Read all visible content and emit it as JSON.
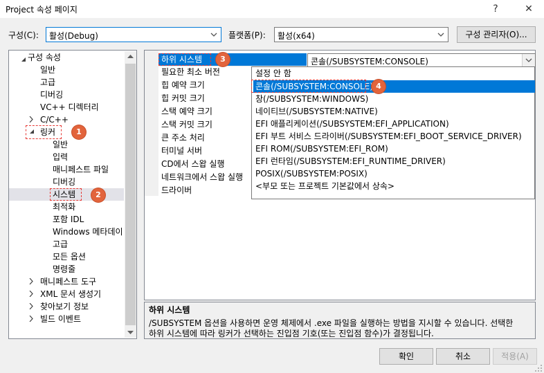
{
  "window": {
    "title": "Project 속성 페이지",
    "help_glyph": "?",
    "close_glyph": "✕"
  },
  "toolbar": {
    "config_label": "구성(C):",
    "config_value": "활성(Debug)",
    "platform_label": "플랫폼(P):",
    "platform_value": "활성(x64)",
    "config_manager_label": "구성 관리자(O)..."
  },
  "tree": {
    "items": [
      {
        "label": "구성 속성",
        "expanded": true
      },
      {
        "label": "일반"
      },
      {
        "label": "고급"
      },
      {
        "label": "디버깅"
      },
      {
        "label": "VC++ 디렉터리"
      },
      {
        "label": "C/C++",
        "expanded": false
      },
      {
        "label": "링커",
        "expanded": true
      },
      {
        "label": "일반"
      },
      {
        "label": "입력"
      },
      {
        "label": "매니페스트 파일"
      },
      {
        "label": "디버깅"
      },
      {
        "label": "시스템",
        "selected": true
      },
      {
        "label": "최적화"
      },
      {
        "label": "포함 IDL"
      },
      {
        "label": "Windows 메타데이"
      },
      {
        "label": "고급"
      },
      {
        "label": "모든 옵션"
      },
      {
        "label": "명령줄"
      },
      {
        "label": "매니페스트 도구",
        "expanded": false
      },
      {
        "label": "XML 문서 생성기",
        "expanded": false
      },
      {
        "label": "찾아보기 정보",
        "expanded": false
      },
      {
        "label": "빌드 이벤트",
        "expanded": false
      }
    ]
  },
  "properties": {
    "selected_name": "하위 시스템",
    "selected_value": "콘솔(/SUBSYSTEM:CONSOLE)",
    "names": [
      "하위 시스템",
      "필요한 최소 버전",
      "힙 예약 크기",
      "힙 커밋 크기",
      "스택 예약 크기",
      "스택 커밋 크기",
      "큰 주소 처리",
      "터미널 서버",
      "CD에서 스왑 실행",
      "네트워크에서 스왑 실행",
      "드라이버"
    ]
  },
  "dropdown": {
    "options": [
      "설정 안 함",
      "콘솔(/SUBSYSTEM:CONSOLE)",
      "창(/SUBSYSTEM:WINDOWS)",
      "네이티브(/SUBSYSTEM:NATIVE)",
      "EFI 애플리케이션(/SUBSYSTEM:EFI_APPLICATION)",
      "EFI 부트 서비스 드라이버(/SUBSYSTEM:EFI_BOOT_SERVICE_DRIVER)",
      "EFI ROM(/SUBSYSTEM:EFI_ROM)",
      "EFI 런타임(/SUBSYSTEM:EFI_RUNTIME_DRIVER)",
      "POSIX(/SUBSYSTEM:POSIX)",
      "<부모 또는 프로젝트 기본값에서 상속>"
    ],
    "selected_index": 1
  },
  "description": {
    "title": "하위 시스템",
    "line1": "/SUBSYSTEM 옵션을 사용하면 운영 체제에서 .exe 파일을 실행하는 방법을 지시할 수 있습니다. 선택한",
    "line2": "하위 시스템에 따라 링커가 선택하는 진입점 기호(또는 진입점 함수)가 결정됩니다."
  },
  "footer": {
    "ok_label": "확인",
    "cancel_label": "취소",
    "apply_label": "적용(A)"
  },
  "markers": [
    "1",
    "2",
    "3",
    "4"
  ],
  "colors": {
    "selection_blue": "#0078d7",
    "marker_orange": "#e2643c",
    "dashed_red": "#e53935"
  }
}
